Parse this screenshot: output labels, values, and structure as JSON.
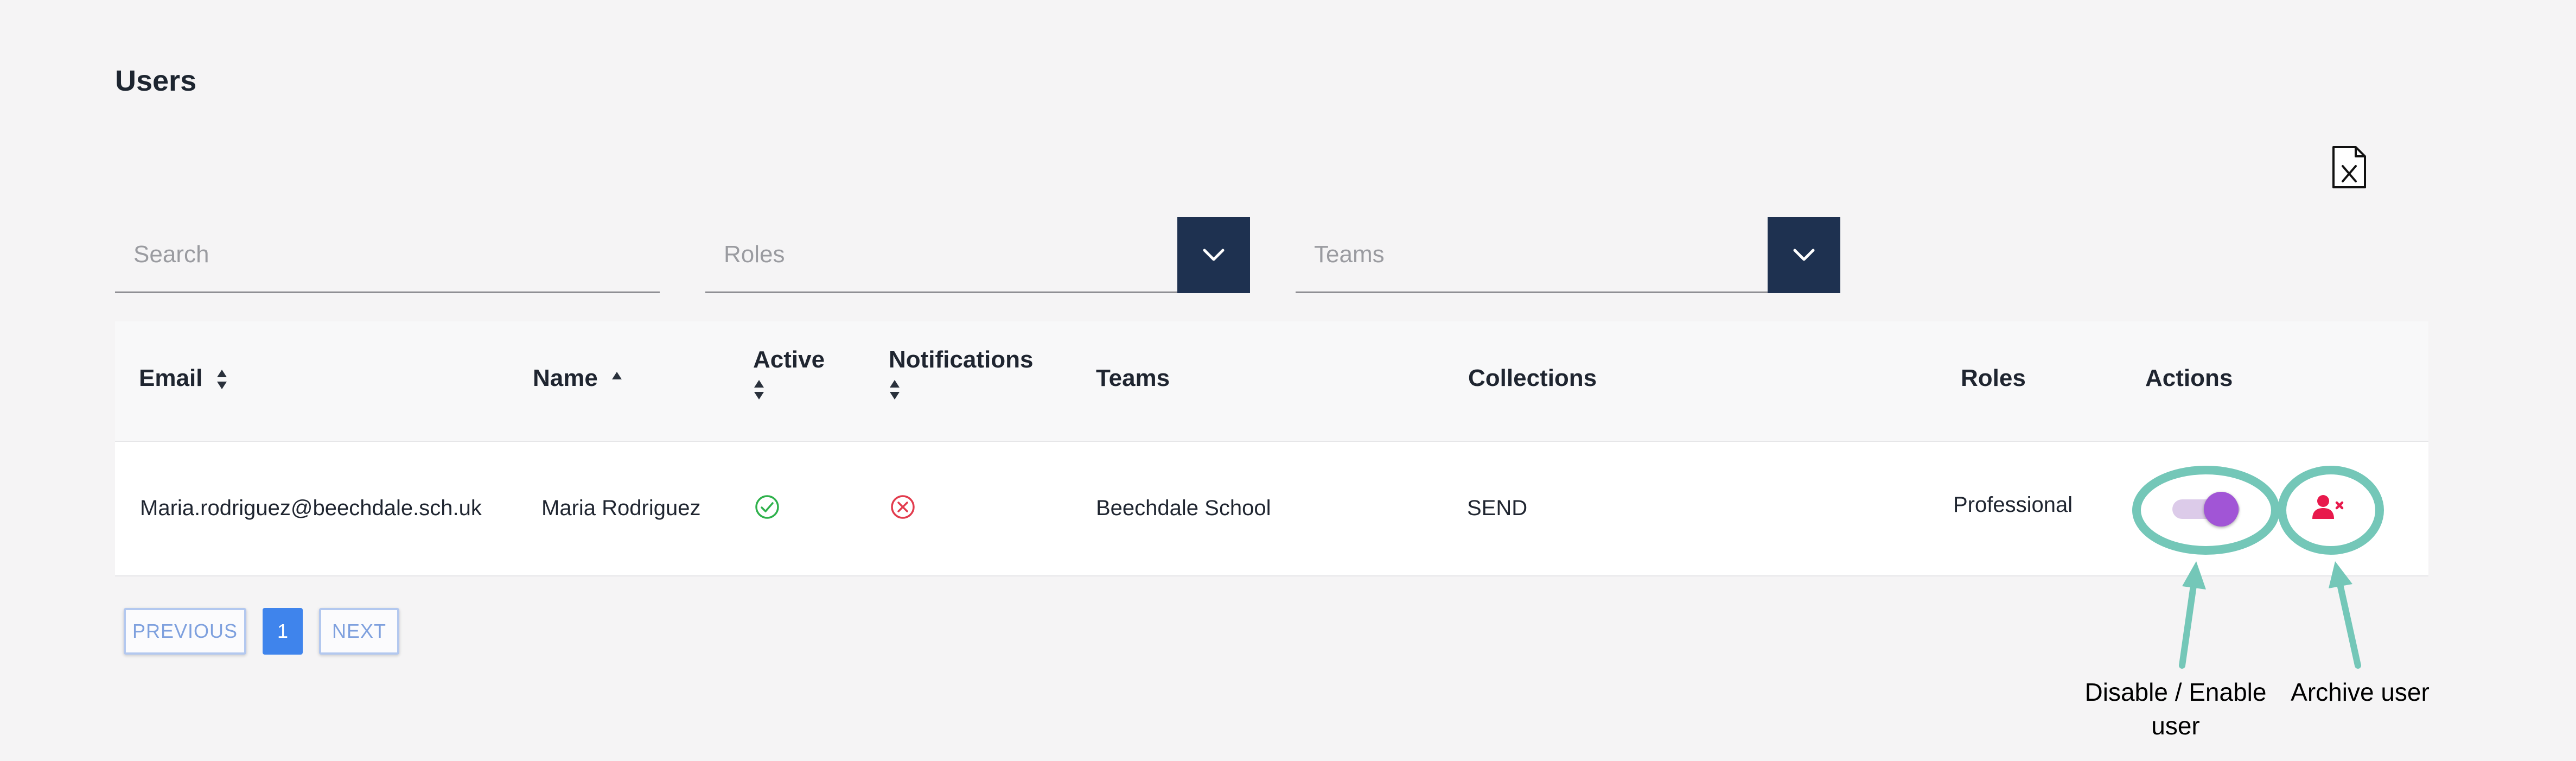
{
  "page": {
    "title": "Users"
  },
  "filters": {
    "search_placeholder": "Search",
    "roles_placeholder": "Roles",
    "teams_placeholder": "Teams"
  },
  "table": {
    "headers": {
      "email": "Email",
      "name": "Name",
      "active": "Active",
      "notifications": "Notifications",
      "teams": "Teams",
      "collections": "Collections",
      "roles": "Roles",
      "actions": "Actions"
    },
    "rows": [
      {
        "email": "Maria.rodriguez@beechdale.sch.uk",
        "name": "Maria Rodriguez",
        "active": true,
        "notifications": false,
        "teams": "Beechdale School",
        "collections": "SEND",
        "roles": "Professional",
        "enabled": true
      }
    ]
  },
  "pagination": {
    "previous": "PREVIOUS",
    "current": "1",
    "next": "NEXT"
  },
  "annotations": {
    "toggle_line1": "Disable / Enable",
    "toggle_line2": "user",
    "archive": "Archive user"
  },
  "colors": {
    "dropdown_bg": "#1e3150",
    "active_icon": "#2fb14c",
    "inactive_icon": "#e23b4d",
    "archive_icon": "#e8194c",
    "toggle_knob": "#a155d6",
    "annotation": "#74c7b8",
    "page_current": "#3f84ec"
  },
  "icons": {
    "export": "excel-export-icon",
    "active": "check-circle-icon",
    "notifications": "x-circle-icon",
    "archive": "remove-user-icon"
  }
}
